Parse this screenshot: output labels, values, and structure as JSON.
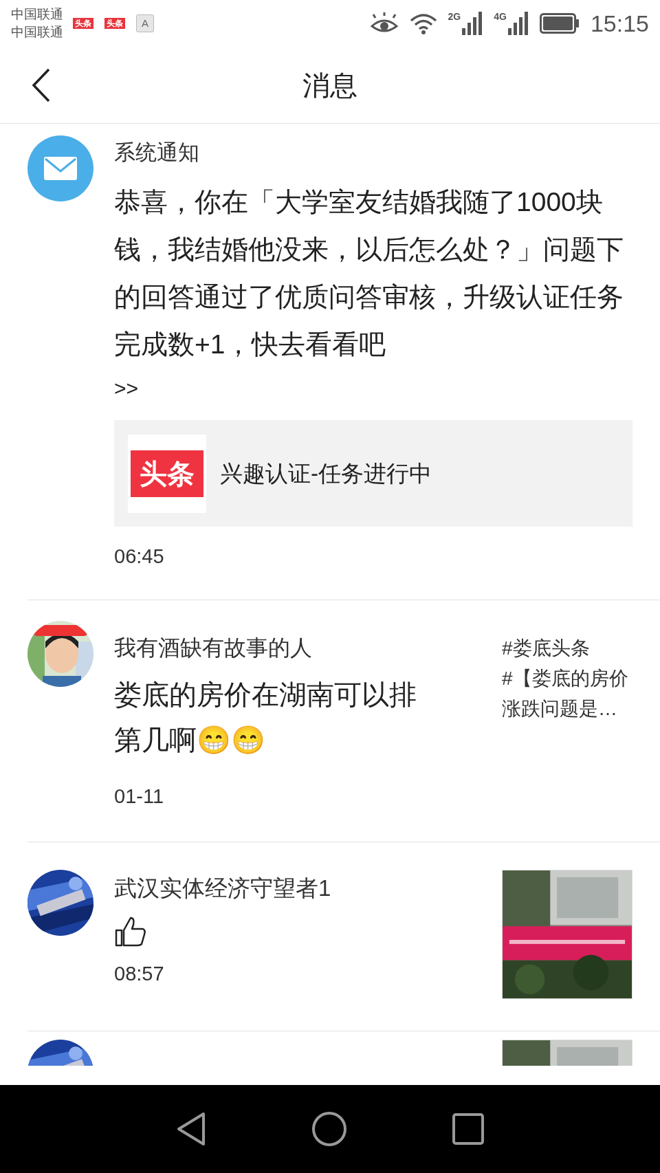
{
  "status_bar": {
    "carriers": [
      "中国联通",
      "中国联通"
    ],
    "badges": [
      {
        "kind": "app",
        "text": "头条"
      },
      {
        "kind": "app",
        "text": "头条"
      },
      {
        "kind": "key",
        "text": "A"
      }
    ],
    "signals": [
      {
        "network": "2G"
      },
      {
        "network": "4G"
      }
    ],
    "time": "15:15"
  },
  "header": {
    "title": "消息"
  },
  "messages": [
    {
      "kind": "system",
      "sender": "系统通知",
      "body": "恭喜，你在「大学室友结婚我随了1000块钱，我结婚他没来，以后怎么处？」问题下的回答通过了优质问答审核，升级认证任务完成数+1，快去看看吧",
      "link": ">>",
      "card": {
        "logo": "头条",
        "title": "兴趣认证-任务进行中"
      },
      "time": "06:45"
    },
    {
      "kind": "comment",
      "sender": "我有酒缺有故事的人",
      "body": "娄底的房价在湖南可以排第几啊😁😁",
      "tags": [
        "#娄底头条",
        "#【娄底的房价涨跌问题是…"
      ],
      "time": "01-11"
    },
    {
      "kind": "like",
      "sender": "武汉实体经济守望者1",
      "time": "08:57"
    },
    {
      "kind": "cut_off"
    }
  ]
}
